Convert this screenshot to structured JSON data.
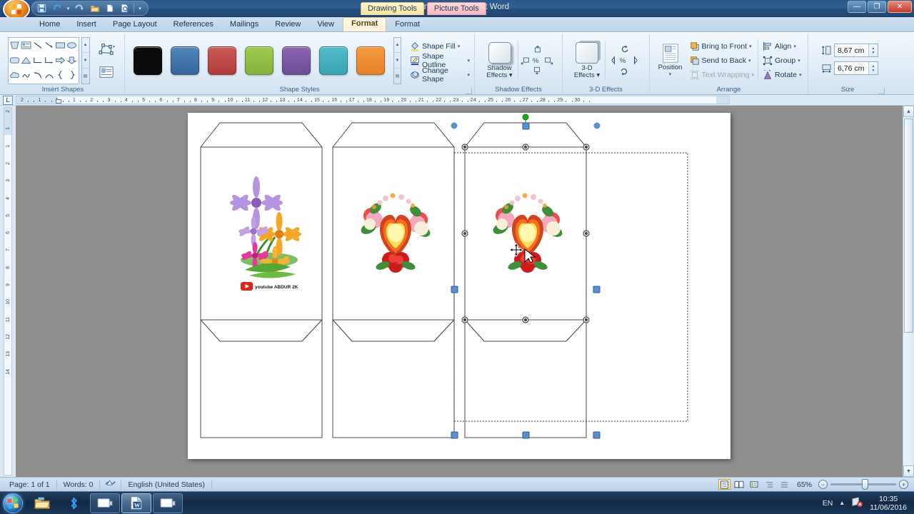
{
  "window": {
    "title": "Document1  -  Microsoft Word",
    "minimize": "—",
    "restore": "❐",
    "close": "✕"
  },
  "quick_access": {
    "items": [
      {
        "name": "save-icon",
        "glyph": "🖫"
      },
      {
        "name": "undo-icon",
        "glyph": "↺"
      },
      {
        "name": "undo-dropdown-icon",
        "glyph": "▾"
      },
      {
        "name": "redo-icon",
        "glyph": "↻"
      },
      {
        "name": "open-icon",
        "glyph": "📂"
      },
      {
        "name": "new-icon",
        "glyph": "🗋"
      },
      {
        "name": "print-preview-icon",
        "glyph": "🔍"
      },
      {
        "name": "customize-qat-icon",
        "glyph": "▾"
      }
    ]
  },
  "contextual_labels": [
    {
      "label": "Drawing Tools",
      "kind": "draw"
    },
    {
      "label": "Picture Tools",
      "kind": "pic"
    }
  ],
  "tabs": [
    {
      "label": "Home",
      "active": false
    },
    {
      "label": "Insert",
      "active": false
    },
    {
      "label": "Page Layout",
      "active": false
    },
    {
      "label": "References",
      "active": false
    },
    {
      "label": "Mailings",
      "active": false
    },
    {
      "label": "Review",
      "active": false
    },
    {
      "label": "View",
      "active": false
    },
    {
      "label": "Format",
      "active": true
    },
    {
      "label": "Format",
      "active": false
    }
  ],
  "ribbon": {
    "insert_shapes": {
      "label": "Insert Shapes",
      "edit_shape_label": "",
      "text_box_label": "",
      "scroll": [
        "▲",
        "▼",
        "▤"
      ]
    },
    "shape_styles": {
      "label": "Shape Styles",
      "swatches": [
        "#0b0b0b",
        "#4276a8",
        "#c14b4b",
        "#93c145",
        "#7d58a5",
        "#45b3bf",
        "#ef8f32"
      ],
      "buttons": [
        {
          "label": "Shape Fill",
          "icon": "fill-icon",
          "glyph": "🖌"
        },
        {
          "label": "Shape Outline",
          "icon": "outline-icon",
          "glyph": "✎"
        },
        {
          "label": "Change Shape",
          "icon": "change-shape-icon",
          "glyph": "⬭"
        }
      ],
      "scroll": [
        "▲",
        "▼",
        "▤"
      ]
    },
    "shadow_effects": {
      "label": "Shadow Effects",
      "button_line1": "Shadow",
      "button_line2": "Effects ▾",
      "nudges": [
        "",
        "⬈",
        "",
        "⬅",
        "%",
        "➡",
        "",
        "⬇",
        ""
      ]
    },
    "three_d_effects": {
      "label": "3-D Effects",
      "button_line1": "3-D",
      "button_line2": "Effects ▾",
      "nudges": [
        "",
        "↻",
        "",
        "◁",
        "%",
        "▷",
        "",
        "↺",
        ""
      ]
    },
    "arrange": {
      "label": "Arrange",
      "position_label": "Position",
      "buttons": [
        {
          "label": "Bring to Front",
          "glyph": "⬘",
          "disabled": false
        },
        {
          "label": "Send to Back",
          "glyph": "⬙",
          "disabled": false
        },
        {
          "label": "Text Wrapping",
          "glyph": "⌗",
          "disabled": true
        },
        {
          "label": "Align",
          "glyph": "⊫",
          "disabled": false
        },
        {
          "label": "Group",
          "glyph": "⬚",
          "disabled": false
        },
        {
          "label": "Rotate",
          "glyph": "◿",
          "disabled": false
        }
      ]
    },
    "size": {
      "label": "Size",
      "height_value": "8,67 cm",
      "width_value": "6,76 cm",
      "height_icon": "shape-height-icon",
      "width_icon": "shape-width-icon"
    }
  },
  "ruler": {
    "tab_selector": "L",
    "h_labels": [
      "2",
      "1",
      "1",
      "1",
      "2",
      "3",
      "4",
      "5",
      "6",
      "7",
      "8",
      "9",
      "10",
      "11",
      "12",
      "13",
      "14",
      "15",
      "16",
      "17",
      "18",
      "19",
      "20",
      "21",
      "22",
      "23",
      "24",
      "25",
      "26",
      "27",
      "28",
      "29",
      "30"
    ],
    "v_labels": [
      "2",
      "1",
      "1",
      "2",
      "3",
      "4",
      "5",
      "6",
      "7",
      "8",
      "9",
      "10",
      "11",
      "12",
      "13",
      "14"
    ]
  },
  "document": {
    "zoom_percent": "65%",
    "watermark_text": "youtube ABDUR 2K",
    "selected_size": {
      "height": "8,67 cm",
      "width": "6,76 cm"
    }
  },
  "status_bar": {
    "page": "Page: 1 of 1",
    "words": "Words: 0",
    "proofing_icon": "proofing-errors-icon",
    "language": "English (United States)",
    "views": [
      {
        "name": "print-layout-view",
        "glyph": "▤",
        "selected": true
      },
      {
        "name": "full-screen-reading-view",
        "glyph": "📖",
        "selected": false
      },
      {
        "name": "web-layout-view",
        "glyph": "🖵",
        "selected": false
      },
      {
        "name": "outline-view",
        "glyph": "⊟",
        "selected": false
      },
      {
        "name": "draft-view",
        "glyph": "☰",
        "selected": false
      }
    ],
    "zoom_out": "−",
    "zoom_in": "+"
  },
  "taskbar": {
    "start_label": "Start",
    "items": [
      {
        "name": "taskbar-explorer",
        "glyph": "📁",
        "active": false,
        "kind": "pin"
      },
      {
        "name": "taskbar-bluetooth",
        "glyph": "🅑",
        "active": false,
        "kind": "pin"
      },
      {
        "name": "taskbar-window-1",
        "glyph": "🖥",
        "active": false,
        "kind": "win"
      },
      {
        "name": "taskbar-word",
        "glyph": "W",
        "active": true,
        "kind": "win"
      },
      {
        "name": "taskbar-window-2",
        "glyph": "🖥",
        "active": false,
        "kind": "win"
      }
    ],
    "language": "EN",
    "show_hidden_icons": "▲",
    "network_icon": "network-error-icon",
    "time": "10:35",
    "date": "11/06/2016"
  }
}
